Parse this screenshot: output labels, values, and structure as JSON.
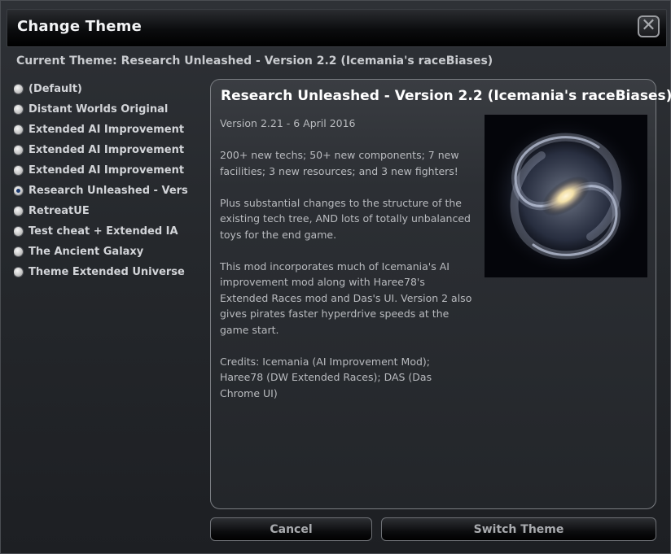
{
  "window": {
    "title": "Change Theme",
    "close_symbol": "✕"
  },
  "current_theme": {
    "text": "Current Theme: Research Unleashed - Version 2.2 (Icemania's raceBiases)"
  },
  "themes": [
    {
      "label": "(Default)",
      "selected": false
    },
    {
      "label": "Distant Worlds Original",
      "selected": false
    },
    {
      "label": "Extended AI Improvement",
      "selected": false
    },
    {
      "label": "Extended AI Improvement",
      "selected": false
    },
    {
      "label": "Extended AI Improvement",
      "selected": false
    },
    {
      "label": "Research Unleashed - Vers",
      "selected": true
    },
    {
      "label": "RetreatUE",
      "selected": false
    },
    {
      "label": "Test cheat + Extended IA",
      "selected": false
    },
    {
      "label": "The Ancient Galaxy",
      "selected": false
    },
    {
      "label": "Theme Extended Universe",
      "selected": false
    }
  ],
  "detail": {
    "title": "Research Unleashed - Version 2.2 (Icemania's raceBiases)",
    "paragraphs": [
      "Version 2.21 - 6 April 2016",
      "200+ new techs; 50+ new components; 7 new facilities; 3 new resources; and 3 new fighters!",
      "Plus substantial changes to the structure of the existing tech tree, AND lots of totally unbalanced toys for the end game.",
      "This mod incorporates much of Icemania's AI improvement mod along with Haree78's Extended Races mod and Das's UI. Version 2 also gives pirates faster hyperdrive speeds at the game start.",
      "Credits: Icemania (AI Improvement Mod); Haree78 (DW Extended Races); DAS (Das Chrome UI)"
    ],
    "image": "galaxy-preview-image"
  },
  "buttons": {
    "cancel": "Cancel",
    "switch": "Switch Theme"
  },
  "colors": {
    "selected_radio": "#1d3b72",
    "title_text": "#ffffff"
  }
}
